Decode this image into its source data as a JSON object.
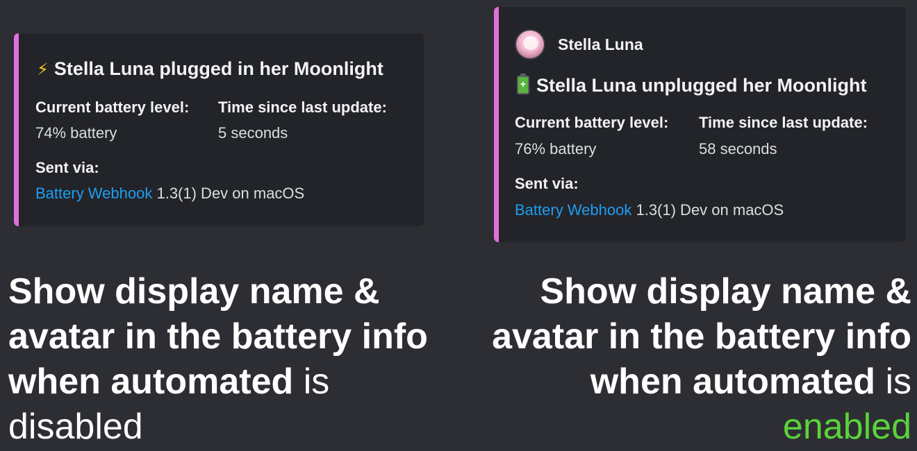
{
  "left_embed": {
    "title_icon": "⚡",
    "title": "Stella Luna plugged in her Moonlight",
    "battery_label": "Current battery level:",
    "battery_value": "74% battery",
    "time_label": "Time since last update:",
    "time_value": "5 seconds",
    "sent_via_label": "Sent via:",
    "app_link": "Battery Webhook",
    "app_details": " 1.3(1) Dev on macOS"
  },
  "right_embed": {
    "author_name": "Stella Luna",
    "title": "Stella Luna unplugged her Moonlight",
    "battery_label": "Current battery level:",
    "battery_value": "76% battery",
    "time_label": "Time since last update:",
    "time_value": "58 seconds",
    "sent_via_label": "Sent via:",
    "app_link": "Battery Webhook",
    "app_details": " 1.3(1) Dev on macOS"
  },
  "caption_left": {
    "line1": "Show display name &",
    "line2": "avatar in the battery info",
    "line3_bold": "when automated",
    "line3_rest": " is",
    "line4": "disabled"
  },
  "caption_right": {
    "line1": "Show display name &",
    "line2": "avatar in the battery info",
    "line3_bold": "when automated",
    "line3_rest": " is",
    "line4": "enabled"
  },
  "colors": {
    "background": "#2d2e33",
    "embed_background": "#232429",
    "embed_stripe": "#e26fdc",
    "link": "#1e9ef0",
    "enabled_green": "#5bd33b"
  },
  "icons": {
    "left_title_icon": "lightning-bolt-icon",
    "right_title_icon": "battery-icon",
    "author_avatar": "avatar"
  }
}
